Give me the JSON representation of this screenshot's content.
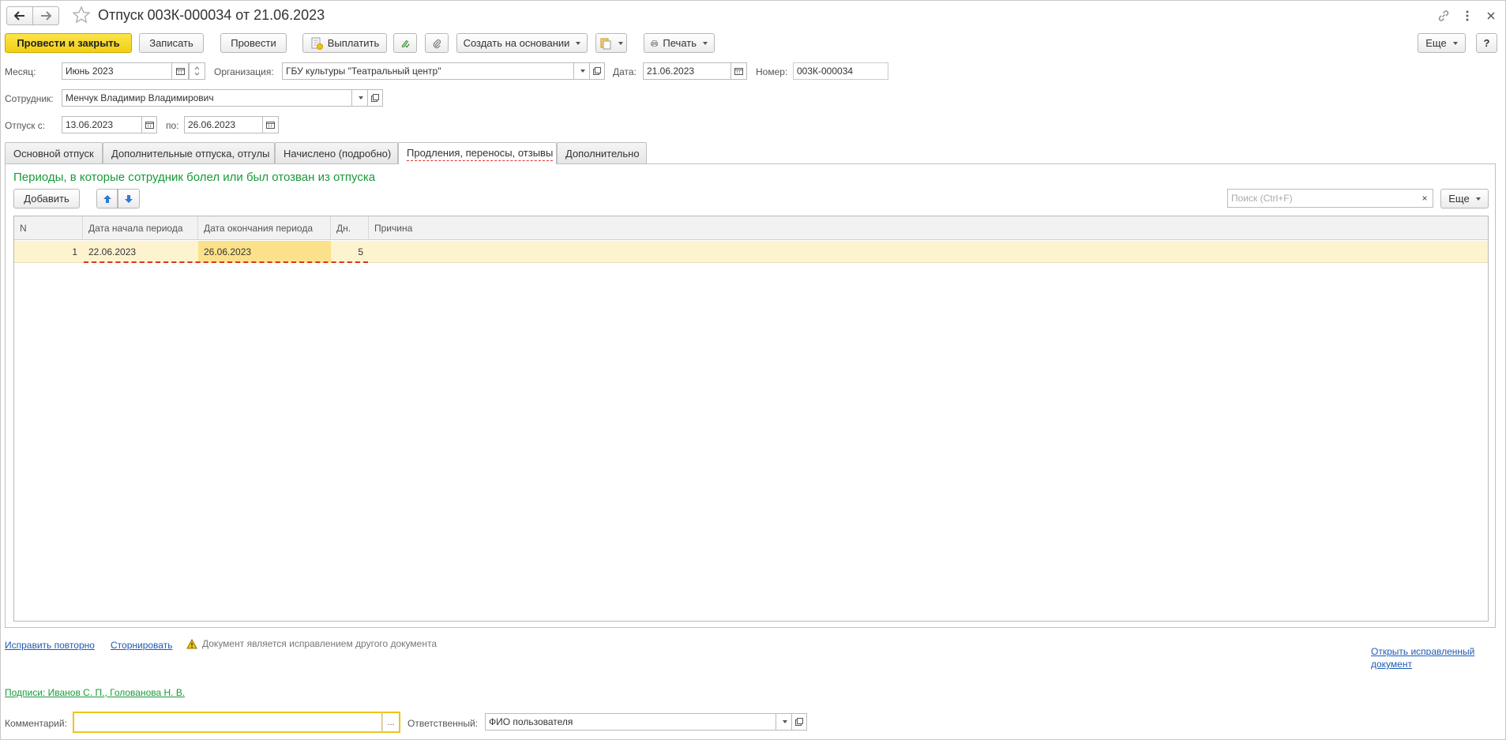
{
  "title": "Отпуск 003К-000034 от 21.06.2023",
  "toolbar": {
    "post_close": "Провести и закрыть",
    "save": "Записать",
    "post": "Провести",
    "pay": "Выплатить",
    "create_based": "Создать на основании",
    "print": "Печать",
    "more": "Еще",
    "help": "?"
  },
  "form": {
    "month_label": "Месяц:",
    "month_value": "Июнь 2023",
    "org_label": "Организация:",
    "org_value": "ГБУ культуры \"Театральный центр\"",
    "date_label": "Дата:",
    "date_value": "21.06.2023",
    "number_label": "Номер:",
    "number_value": "003К-000034",
    "employee_label": "Сотрудник:",
    "employee_value": "Менчук Владимир Владимирович",
    "leave_from_label": "Отпуск с:",
    "leave_from_value": "13.06.2023",
    "leave_to_label": "по:",
    "leave_to_value": "26.06.2023"
  },
  "tabs": [
    {
      "label": "Основной отпуск"
    },
    {
      "label": "Дополнительные отпуска, отгулы"
    },
    {
      "label": "Начислено (подробно)"
    },
    {
      "label": "Продления, переносы, отзывы"
    },
    {
      "label": "Дополнительно"
    }
  ],
  "panel": {
    "section_title": "Периоды, в которые сотрудник болел или был отозван из отпуска",
    "add_button": "Добавить",
    "search_placeholder": "Поиск (Ctrl+F)",
    "search_clear": "×",
    "more": "Еще"
  },
  "table": {
    "columns": [
      "N",
      "Дата начала периода",
      "Дата окончания периода",
      "Дн.",
      "Причина"
    ],
    "rows": [
      {
        "n": "1",
        "start": "22.06.2023",
        "end": "26.06.2023",
        "days": "5",
        "reason": ""
      }
    ]
  },
  "footer": {
    "fix_again": "Исправить повторно",
    "reverse": "Сторнировать",
    "warning": "Документ является исправлением другого документа",
    "open_fixed_line1": "Открыть исправленный",
    "open_fixed_line2": "документ",
    "signatures": "Подписи: Иванов С. П., Голованова Н. В.",
    "comment_label": "Комментарий:",
    "comment_value": "",
    "comment_button": "...",
    "responsible_label": "Ответственный:",
    "responsible_value": "ФИО пользователя"
  },
  "colors": {
    "primary_button": "#f3cf12",
    "section_title": "#1a9a3a",
    "link": "#1f5bb5",
    "selected_row": "#fdf4cf",
    "error_underline": "#e03030"
  }
}
